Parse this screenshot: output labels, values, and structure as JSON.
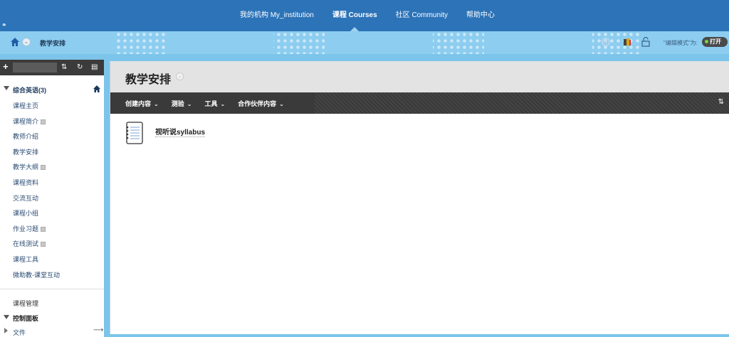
{
  "topnav": {
    "tabs": [
      {
        "label": "我的机构 My_institution",
        "active": false
      },
      {
        "label": "课程 Courses",
        "active": true
      },
      {
        "label": "社区 Community",
        "active": false
      },
      {
        "label": "帮助中心",
        "active": false
      }
    ]
  },
  "breadcrumb": {
    "current": "教学安排",
    "edit_mode_label": "\"编辑模式\"为:",
    "edit_mode_value": "打开"
  },
  "sidebar": {
    "course_title": "综合英语(3)",
    "items": [
      {
        "label": "课程主页",
        "hidden_marker": false
      },
      {
        "label": "课程简介",
        "hidden_marker": true
      },
      {
        "label": "教师介绍",
        "hidden_marker": false
      },
      {
        "label": "教学安排",
        "hidden_marker": false
      },
      {
        "label": "教学大纲",
        "hidden_marker": true
      },
      {
        "label": "课程资料",
        "hidden_marker": false
      },
      {
        "label": "交流互动",
        "hidden_marker": false
      },
      {
        "label": "课程小组",
        "hidden_marker": false
      },
      {
        "label": "作业习题",
        "hidden_marker": true
      },
      {
        "label": "在线测试",
        "hidden_marker": true
      },
      {
        "label": "课程工具",
        "hidden_marker": false
      },
      {
        "label": "微助教-课堂互动",
        "hidden_marker": false
      }
    ],
    "management_label": "课程管理",
    "control_panel_label": "控制面板",
    "files_label": "文件"
  },
  "main": {
    "page_title": "教学安排",
    "actions": [
      {
        "label": "创建内容"
      },
      {
        "label": "测验"
      },
      {
        "label": "工具"
      },
      {
        "label": "合作伙伴内容"
      }
    ],
    "content_items": [
      {
        "title": "视听说syllabus",
        "icon": "document-icon"
      }
    ]
  },
  "colors": {
    "topnav_bg": "#2c73b8",
    "crumbbar_bg": "#8ccdf0",
    "action_bar_bg": "#3e3e3e",
    "edit_on_dot": "#7ad34b"
  }
}
